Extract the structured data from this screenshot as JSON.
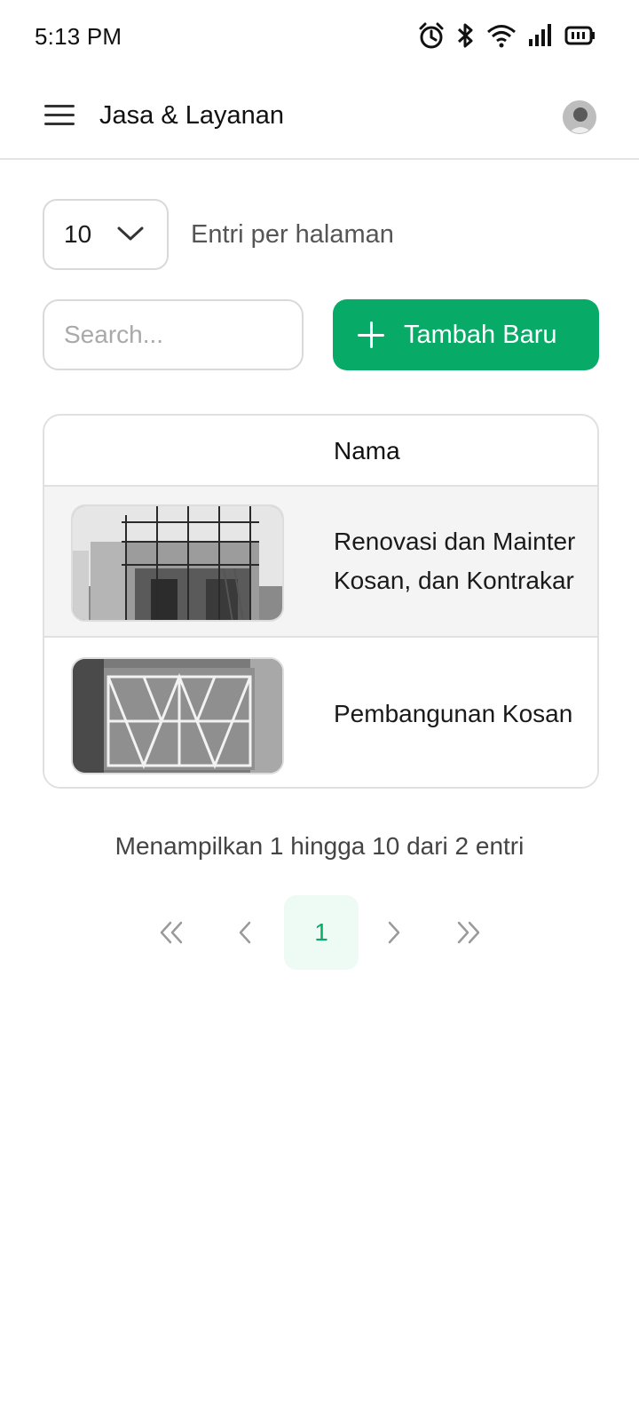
{
  "status_bar": {
    "time": "5:13 PM",
    "icons": [
      "alarm-icon",
      "bluetooth-icon",
      "wifi-icon",
      "signal-icon",
      "battery-icon"
    ]
  },
  "header": {
    "title": "Jasa & Layanan",
    "menu_icon": "hamburger-menu-icon",
    "avatar": "user-avatar"
  },
  "controls": {
    "page_size_value": "10",
    "page_size_label": "Entri per halaman",
    "search_placeholder": "Search...",
    "add_button_label": "Tambah Baru"
  },
  "table": {
    "columns": [
      "",
      "Nama"
    ],
    "rows": [
      {
        "name_line1": "Renovasi dan Mainter",
        "name_line2": "Kosan, dan Kontrakar"
      },
      {
        "name_line1": "Pembangunan Kosan"
      }
    ]
  },
  "pagination": {
    "info": "Menampilkan 1 hingga 10 dari 2 entri",
    "current_page": "1"
  },
  "colors": {
    "accent": "#07ab67",
    "accent_light": "#eefaf4",
    "row_highlight": "#f4f4f4"
  }
}
